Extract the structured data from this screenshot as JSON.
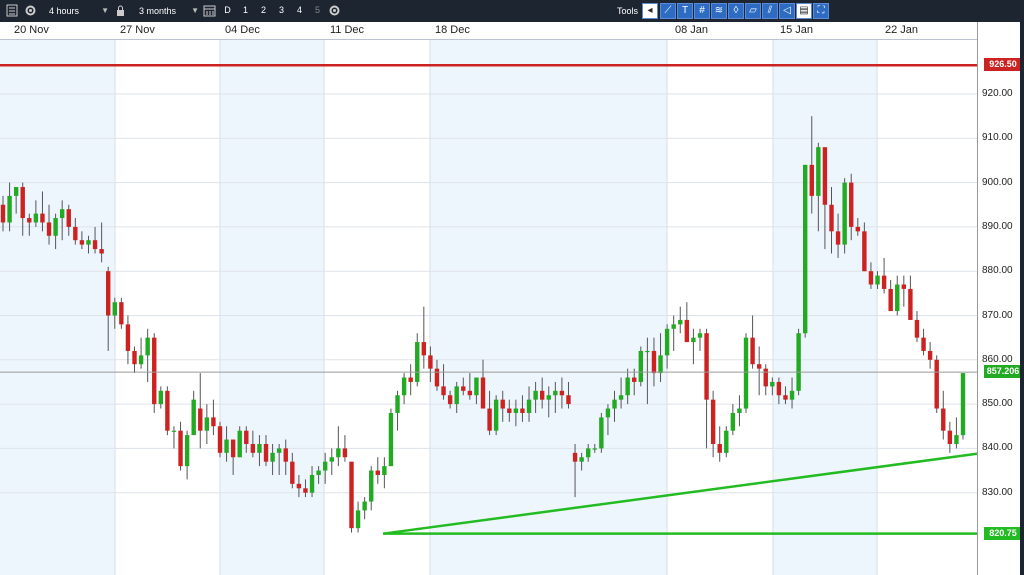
{
  "toolbar": {
    "interval": "4 hours",
    "range": "3 months",
    "period_buttons": [
      "D",
      "1",
      "2",
      "3",
      "4",
      "5"
    ],
    "tools_label": "Tools"
  },
  "date_labels": [
    "20 Nov",
    "27 Nov",
    "04 Dec",
    "11 Dec",
    "18 Dec",
    "08 Jan",
    "15 Jan",
    "22 Jan"
  ],
  "y_axis": {
    "ticks": [
      "920.00",
      "910.00",
      "900.00",
      "890.00",
      "880.00",
      "870.00",
      "860.00",
      "850.00",
      "840.00",
      "830.00"
    ],
    "tick_values": [
      920,
      910,
      900,
      890,
      880,
      870,
      860,
      850,
      840,
      830
    ]
  },
  "levels": {
    "resistance": {
      "label": "926.50",
      "value": 926.5,
      "color": "#cc2222"
    },
    "current": {
      "label": "857.206",
      "value": 857.206,
      "color": "#22aa22"
    },
    "support": {
      "label": "820.75",
      "value": 820.75,
      "color": "#22bb22"
    }
  },
  "colors": {
    "up": "#22aa22",
    "down": "#cc2222",
    "shade": "#eef6fd"
  },
  "chart_data": {
    "type": "candlestick",
    "ylim": [
      817,
      930
    ],
    "series": [
      [
        895,
        897,
        889,
        891
      ],
      [
        891,
        900,
        889,
        897
      ],
      [
        897,
        899,
        893,
        899
      ],
      [
        899,
        900,
        888,
        892
      ],
      [
        892,
        893,
        888,
        891
      ],
      [
        891,
        896,
        890,
        893
      ],
      [
        893,
        898,
        889,
        891
      ],
      [
        891,
        895,
        886,
        888
      ],
      [
        888,
        893,
        885,
        892
      ],
      [
        892,
        896,
        887,
        894
      ],
      [
        894,
        895,
        888,
        890
      ],
      [
        890,
        892,
        886,
        887
      ],
      [
        887,
        889,
        885,
        886
      ],
      [
        886,
        888,
        884,
        887
      ],
      [
        887,
        890,
        884,
        885
      ],
      [
        885,
        891,
        882,
        884
      ],
      [
        880,
        881,
        862,
        870
      ],
      [
        870,
        874,
        867,
        873
      ],
      [
        873,
        874,
        867,
        868
      ],
      [
        868,
        870,
        859,
        862
      ],
      [
        862,
        863,
        857,
        859
      ],
      [
        859,
        865,
        858,
        861
      ],
      [
        861,
        867,
        855,
        865
      ],
      [
        865,
        866,
        848,
        850
      ],
      [
        850,
        854,
        849,
        853
      ],
      [
        853,
        854,
        843,
        844
      ],
      [
        844,
        845,
        840,
        844
      ],
      [
        844,
        846,
        835,
        836
      ],
      [
        836,
        844,
        833,
        843
      ],
      [
        843,
        853,
        844,
        851
      ],
      [
        849,
        857,
        840,
        844
      ],
      [
        844,
        850,
        841,
        847
      ],
      [
        847,
        851,
        843,
        845
      ],
      [
        845,
        846,
        838,
        839
      ],
      [
        839,
        845,
        837,
        842
      ],
      [
        842,
        842,
        834,
        838
      ],
      [
        838,
        845,
        838,
        844
      ],
      [
        844,
        845,
        839,
        841
      ],
      [
        841,
        844,
        838,
        839
      ],
      [
        839,
        843,
        836,
        841
      ],
      [
        841,
        843,
        836,
        837
      ],
      [
        837,
        841,
        834,
        839
      ],
      [
        839,
        841,
        834,
        840
      ],
      [
        840,
        842,
        834,
        837
      ],
      [
        837,
        839,
        831,
        832
      ],
      [
        832,
        834,
        829,
        831
      ],
      [
        831,
        833,
        829,
        830
      ],
      [
        830,
        836,
        829,
        834
      ],
      [
        834,
        836,
        832,
        835
      ],
      [
        835,
        839,
        832,
        837
      ],
      [
        837,
        840,
        834,
        838
      ],
      [
        838,
        845,
        836,
        840
      ],
      [
        840,
        843,
        837,
        838
      ],
      [
        837,
        837,
        821,
        822
      ],
      [
        822,
        828,
        821,
        826
      ],
      [
        826,
        829,
        824,
        828
      ],
      [
        828,
        836,
        826,
        835
      ],
      [
        835,
        838,
        832,
        834
      ],
      [
        834,
        838,
        831,
        836
      ],
      [
        836,
        849,
        836,
        848
      ],
      [
        848,
        853,
        844,
        852
      ],
      [
        852,
        857,
        850,
        856
      ],
      [
        856,
        859,
        852,
        855
      ],
      [
        855,
        866,
        854,
        864
      ],
      [
        864,
        872,
        858,
        861
      ],
      [
        861,
        863,
        855,
        858
      ],
      [
        858,
        860,
        853,
        854
      ],
      [
        854,
        859,
        851,
        852
      ],
      [
        852,
        853,
        849,
        850
      ],
      [
        850,
        855,
        848,
        854
      ],
      [
        854,
        856,
        852,
        853
      ],
      [
        853,
        857,
        851,
        852
      ],
      [
        852,
        856,
        850,
        856
      ],
      [
        856,
        860,
        850,
        849
      ],
      [
        849,
        853,
        843,
        844
      ],
      [
        844,
        852,
        843,
        851
      ],
      [
        851,
        853,
        846,
        849
      ],
      [
        849,
        851,
        846,
        848
      ],
      [
        848,
        851,
        845,
        849
      ],
      [
        849,
        852,
        846,
        848
      ],
      [
        848,
        854,
        846,
        851
      ],
      [
        851,
        855,
        848,
        853
      ],
      [
        853,
        856,
        849,
        851
      ],
      [
        851,
        854,
        847,
        852
      ],
      [
        852,
        855,
        848,
        853
      ],
      [
        853,
        856,
        849,
        852
      ],
      [
        852,
        855,
        849,
        850
      ],
      [
        839,
        841,
        829,
        837
      ],
      [
        837,
        839,
        835,
        838
      ],
      [
        838,
        841,
        837,
        840
      ],
      [
        840,
        841,
        839,
        840
      ],
      [
        840,
        848,
        839,
        847
      ],
      [
        847,
        850,
        843,
        849
      ],
      [
        849,
        853,
        846,
        851
      ],
      [
        851,
        856,
        849,
        852
      ],
      [
        852,
        858,
        850,
        856
      ],
      [
        856,
        858,
        852,
        855
      ],
      [
        855,
        863,
        854,
        862
      ],
      [
        862,
        865,
        850,
        862
      ],
      [
        862,
        865,
        854,
        857
      ],
      [
        857,
        866,
        855,
        861
      ],
      [
        861,
        868,
        858,
        867
      ],
      [
        867,
        870,
        862,
        868
      ],
      [
        868,
        872,
        866,
        869
      ],
      [
        869,
        873,
        865,
        864
      ],
      [
        864,
        867,
        859,
        865
      ],
      [
        865,
        867,
        862,
        866
      ],
      [
        866,
        867,
        840,
        851
      ],
      [
        851,
        853,
        838,
        841
      ],
      [
        841,
        845,
        837,
        839
      ],
      [
        839,
        845,
        838,
        844
      ],
      [
        844,
        850,
        843,
        848
      ],
      [
        848,
        852,
        845,
        849
      ],
      [
        849,
        866,
        848,
        865
      ],
      [
        865,
        870,
        858,
        859
      ],
      [
        859,
        863,
        852,
        858
      ],
      [
        858,
        859,
        852,
        854
      ],
      [
        854,
        856,
        852,
        855
      ],
      [
        855,
        856,
        850,
        852
      ],
      [
        852,
        854,
        850,
        851
      ],
      [
        851,
        856,
        849,
        853
      ],
      [
        853,
        867,
        852,
        866
      ],
      [
        866,
        904,
        865,
        904
      ],
      [
        904,
        915,
        893,
        897
      ],
      [
        897,
        909,
        889,
        908
      ],
      [
        908,
        906,
        885,
        895
      ],
      [
        895,
        899,
        884,
        889
      ],
      [
        889,
        893,
        883,
        886
      ],
      [
        886,
        901,
        884,
        900
      ],
      [
        900,
        902,
        887,
        890
      ],
      [
        890,
        892,
        888,
        889
      ],
      [
        889,
        891,
        880,
        880
      ],
      [
        880,
        882,
        876,
        877
      ],
      [
        877,
        880,
        876,
        879
      ],
      [
        879,
        883,
        875,
        876
      ],
      [
        876,
        878,
        871,
        871
      ],
      [
        871,
        879,
        870,
        877
      ],
      [
        877,
        879,
        872,
        876
      ],
      [
        876,
        879,
        869,
        869
      ],
      [
        869,
        871,
        864,
        865
      ],
      [
        865,
        867,
        861,
        862
      ],
      [
        862,
        864,
        858,
        860
      ],
      [
        860,
        861,
        848,
        849
      ],
      [
        849,
        853,
        842,
        844
      ],
      [
        844,
        846,
        839,
        841
      ],
      [
        841,
        847,
        840,
        843
      ],
      [
        843,
        857,
        842,
        857
      ]
    ],
    "series_format": "open, high, low, close per 4-hour bar"
  }
}
